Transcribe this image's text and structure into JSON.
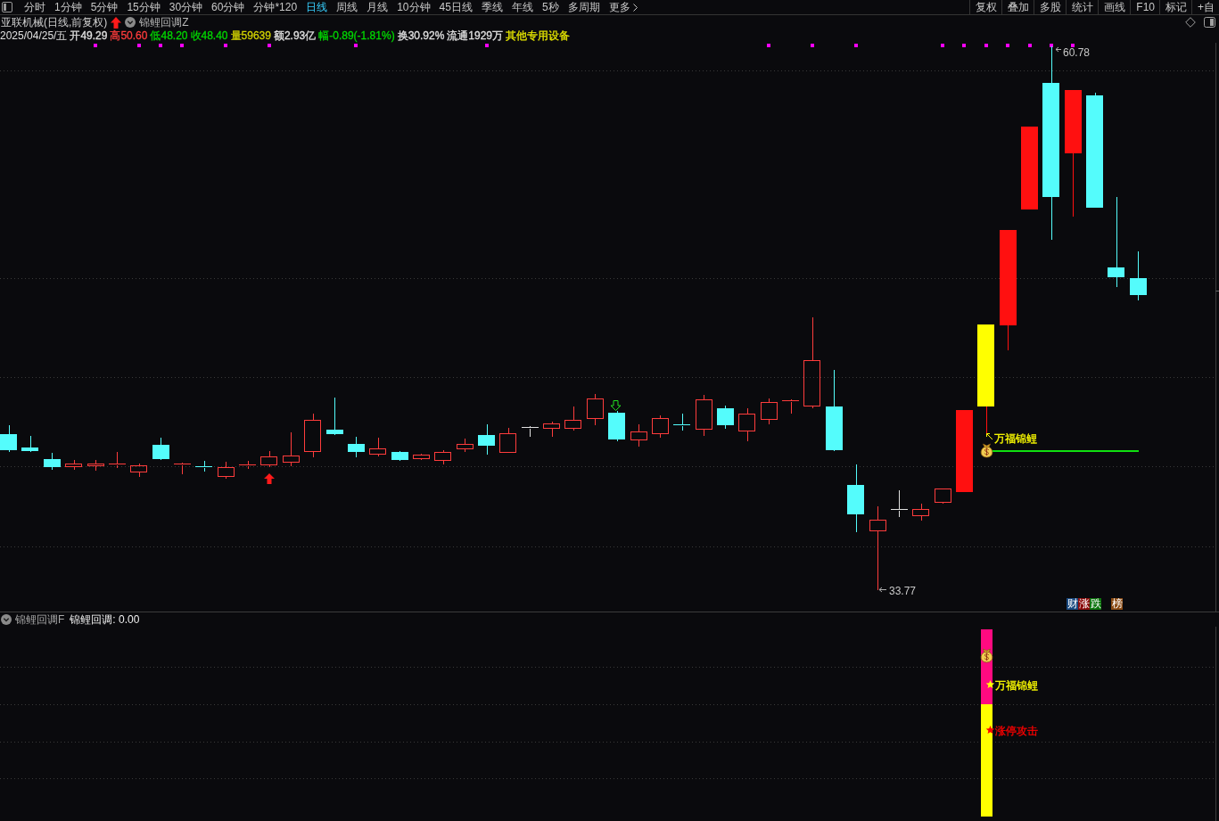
{
  "toolbar": {
    "periods": [
      {
        "label": "分时",
        "selected": false
      },
      {
        "label": "1分钟",
        "selected": false
      },
      {
        "label": "5分钟",
        "selected": false
      },
      {
        "label": "15分钟",
        "selected": false
      },
      {
        "label": "30分钟",
        "selected": false
      },
      {
        "label": "60分钟",
        "selected": false
      },
      {
        "label": "分钟*120",
        "selected": false
      },
      {
        "label": "日线",
        "selected": true
      },
      {
        "label": "周线",
        "selected": false
      },
      {
        "label": "月线",
        "selected": false
      },
      {
        "label": "10分钟",
        "selected": false
      },
      {
        "label": "45日线",
        "selected": false
      },
      {
        "label": "季线",
        "selected": false
      },
      {
        "label": "年线",
        "selected": false
      },
      {
        "label": "5秒",
        "selected": false
      },
      {
        "label": "多周期",
        "selected": false
      },
      {
        "label": "更多",
        "selected": false
      }
    ],
    "tools": [
      "复权",
      "叠加",
      "多股",
      "统计",
      "画线",
      "F10",
      "标记",
      "+自"
    ]
  },
  "chart_header": {
    "title": "亚联机械(日线,前复权)",
    "formula": "锦鲤回调Z"
  },
  "quote": {
    "date": "2025/04/25/五",
    "fields": [
      {
        "text": "开49.29",
        "color": "#e0e0e0"
      },
      {
        "text": "高50.60",
        "color": "#ff3c3c"
      },
      {
        "text": "低48.20",
        "color": "#00d800"
      },
      {
        "text": "收48.40",
        "color": "#00d800"
      },
      {
        "text": "量59639",
        "color": "#d2d200"
      },
      {
        "text": "额2.93亿",
        "color": "#e0e0e0"
      },
      {
        "text": "幅-0.89(-1.81%)",
        "color": "#00d800"
      },
      {
        "text": "换30.92%",
        "color": "#e0e0e0"
      },
      {
        "text": "流通1929万",
        "color": "#e0e0e0"
      },
      {
        "text": "其他专用设备",
        "color": "#e6e600"
      }
    ]
  },
  "main_chart": {
    "high_label": "60.78",
    "low_label": "33.77",
    "annotation": "万福锦鲤",
    "tag_groups": [
      [
        {
          "text": "财",
          "color": "#1a4a80"
        },
        {
          "text": "涨",
          "color": "#8c0c0c"
        },
        {
          "text": "跌",
          "color": "#0c740c"
        }
      ],
      [
        {
          "text": "榜",
          "color": "#8a4a12"
        }
      ]
    ]
  },
  "indicator_panel": {
    "name": "锦鲤回调F",
    "readout": "锦鲤回调: 0.00",
    "signals": [
      {
        "text": "万福锦鲤",
        "color": "#ffff00"
      },
      {
        "text": "涨停攻击",
        "color": "#ff0000"
      }
    ]
  }
}
